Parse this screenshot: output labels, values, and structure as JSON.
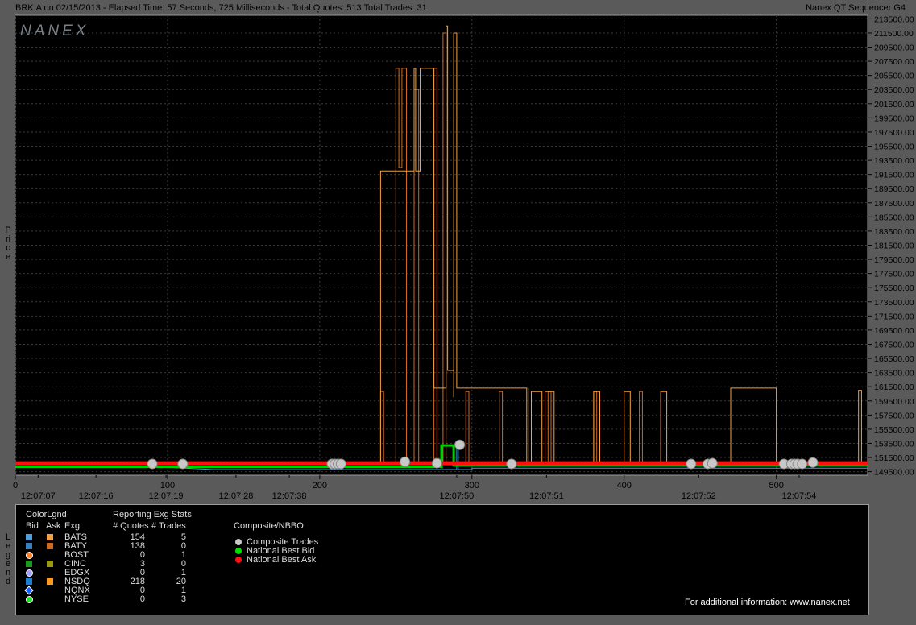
{
  "header": {
    "left": "BRK.A on 02/15/2013  -  Elapsed Time: 57 Seconds, 725 Milliseconds  -  Total Quotes: 513  Total Trades: 31",
    "right": "Nanex QT Sequencer G4"
  },
  "watermark": "NANEX",
  "price_axis_title": "Price",
  "legend_axis_title": "Legend",
  "chart_data": {
    "type": "line",
    "y_ticks": [
      "213500.00",
      "211500.00",
      "209500.00",
      "207500.00",
      "205500.00",
      "203500.00",
      "201500.00",
      "199500.00",
      "197500.00",
      "195500.00",
      "193500.00",
      "191500.00",
      "189500.00",
      "187500.00",
      "185500.00",
      "183500.00",
      "181500.00",
      "179500.00",
      "177500.00",
      "175500.00",
      "173500.00",
      "171500.00",
      "169500.00",
      "167500.00",
      "165500.00",
      "163500.00",
      "161500.00",
      "159500.00",
      "157500.00",
      "155500.00",
      "153500.00",
      "151500.00",
      "149500.00"
    ],
    "ylim": [
      149000,
      214000
    ],
    "xlim": [
      0,
      560
    ],
    "x_ticks": [
      0,
      100,
      200,
      300,
      400,
      500
    ],
    "x_tick_labels": [
      "0",
      "100",
      "200",
      "300",
      "400",
      "500"
    ],
    "time_labels": [
      {
        "x": 15,
        "t": "12:07:07"
      },
      {
        "x": 53,
        "t": "12:07:16"
      },
      {
        "x": 99,
        "t": "12:07:19"
      },
      {
        "x": 145,
        "t": "12:07:28"
      },
      {
        "x": 180,
        "t": "12:07:38"
      },
      {
        "x": 290,
        "t": "12:07:50"
      },
      {
        "x": 349,
        "t": "12:07:51"
      },
      {
        "x": 449,
        "t": "12:07:52"
      },
      {
        "x": 515,
        "t": "12:07:54"
      }
    ],
    "grid": true,
    "series": [
      {
        "id": "baty_ask",
        "color": "#d2691e",
        "points": [
          [
            0,
            150500
          ],
          [
            240,
            150500
          ],
          [
            240,
            160800
          ],
          [
            242,
            160800
          ],
          [
            242,
            150500
          ],
          [
            250,
            150500
          ],
          [
            250,
            206500
          ],
          [
            252,
            206500
          ],
          [
            252,
            192500
          ],
          [
            254,
            192500
          ],
          [
            254,
            206500
          ],
          [
            257,
            206500
          ],
          [
            257,
            150500
          ],
          [
            262,
            150500
          ],
          [
            262,
            203500
          ],
          [
            265,
            203500
          ],
          [
            265,
            150500
          ],
          [
            275,
            150500
          ],
          [
            275,
            206500
          ],
          [
            277,
            206500
          ],
          [
            277,
            150500
          ],
          [
            281,
            150500
          ],
          [
            281,
            211500
          ],
          [
            283,
            211500
          ],
          [
            283,
            150500
          ],
          [
            296,
            150500
          ],
          [
            296,
            160800
          ],
          [
            298,
            160800
          ],
          [
            298,
            150500
          ],
          [
            318,
            150500
          ],
          [
            318,
            160800
          ],
          [
            320,
            160800
          ],
          [
            320,
            150500
          ],
          [
            350,
            150500
          ],
          [
            350,
            160800
          ],
          [
            352,
            160800
          ],
          [
            352,
            150500
          ],
          [
            380,
            150500
          ],
          [
            380,
            160800
          ],
          [
            382,
            160800
          ],
          [
            382,
            150500
          ],
          [
            410,
            150500
          ],
          [
            410,
            160800
          ],
          [
            412,
            160800
          ],
          [
            412,
            150500
          ],
          [
            560,
            150500
          ]
        ]
      },
      {
        "id": "nsdq_ask",
        "color": "#f5a040",
        "points": [
          [
            0,
            150600
          ],
          [
            240,
            150600
          ],
          [
            240,
            192000
          ],
          [
            262,
            192000
          ],
          [
            262,
            206500
          ],
          [
            263,
            206500
          ],
          [
            263,
            192000
          ],
          [
            266,
            192000
          ],
          [
            266,
            206500
          ],
          [
            275,
            206500
          ],
          [
            275,
            161300
          ],
          [
            283,
            161300
          ],
          [
            283,
            212500
          ],
          [
            284,
            212500
          ],
          [
            284,
            163800
          ],
          [
            288,
            163800
          ],
          [
            288,
            160000
          ],
          [
            288,
            211500
          ],
          [
            290,
            211500
          ],
          [
            290,
            161300
          ],
          [
            300,
            161300
          ],
          [
            300,
            161300
          ],
          [
            336,
            161300
          ],
          [
            336,
            150600
          ],
          [
            337,
            150600
          ],
          [
            337,
            161300
          ],
          [
            337,
            150600
          ],
          [
            339,
            150600
          ],
          [
            339,
            160800
          ],
          [
            346,
            160800
          ],
          [
            346,
            150600
          ],
          [
            348,
            150600
          ],
          [
            348,
            160800
          ],
          [
            354,
            160800
          ],
          [
            354,
            150600
          ],
          [
            380,
            150600
          ],
          [
            380,
            160800
          ],
          [
            384,
            160800
          ],
          [
            384,
            150600
          ],
          [
            400,
            150600
          ],
          [
            400,
            160800
          ],
          [
            404,
            160800
          ],
          [
            404,
            150600
          ],
          [
            424,
            150600
          ],
          [
            424,
            160800
          ],
          [
            428,
            160800
          ],
          [
            428,
            150600
          ],
          [
            470,
            150600
          ],
          [
            470,
            161300
          ],
          [
            500,
            161300
          ],
          [
            500,
            150600
          ],
          [
            554,
            150600
          ],
          [
            554,
            161000
          ],
          [
            556,
            161000
          ],
          [
            556,
            150600
          ],
          [
            560,
            150600
          ]
        ]
      },
      {
        "id": "bats_bid",
        "color": "#4aa0e0",
        "points": [
          [
            0,
            150100
          ],
          [
            100,
            150100
          ],
          [
            130,
            149800
          ],
          [
            290,
            149800
          ],
          [
            290,
            153200
          ],
          [
            291,
            153200
          ],
          [
            291,
            149800
          ],
          [
            300,
            149800
          ],
          [
            300,
            150000
          ],
          [
            560,
            150000
          ]
        ]
      },
      {
        "id": "nbb",
        "color": "#00d000",
        "width": 3,
        "points": [
          [
            0,
            150200
          ],
          [
            280,
            150200
          ],
          [
            280,
            153200
          ],
          [
            288,
            153200
          ],
          [
            288,
            150400
          ],
          [
            560,
            150400
          ]
        ]
      },
      {
        "id": "nba",
        "color": "#ff1010",
        "width": 5,
        "points": [
          [
            0,
            150700
          ],
          [
            560,
            150700
          ]
        ]
      }
    ],
    "trades": [
      {
        "x": 90,
        "y": 150600
      },
      {
        "x": 110,
        "y": 150600
      },
      {
        "x": 208,
        "y": 150600
      },
      {
        "x": 210,
        "y": 150600
      },
      {
        "x": 212,
        "y": 150600
      },
      {
        "x": 214,
        "y": 150600
      },
      {
        "x": 256,
        "y": 150900
      },
      {
        "x": 277,
        "y": 150700
      },
      {
        "x": 292,
        "y": 153300
      },
      {
        "x": 326,
        "y": 150600
      },
      {
        "x": 444,
        "y": 150600
      },
      {
        "x": 455,
        "y": 150600
      },
      {
        "x": 458,
        "y": 150700
      },
      {
        "x": 505,
        "y": 150600
      },
      {
        "x": 510,
        "y": 150600
      },
      {
        "x": 512,
        "y": 150600
      },
      {
        "x": 514,
        "y": 150600
      },
      {
        "x": 517,
        "y": 150600
      },
      {
        "x": 524,
        "y": 150800
      }
    ]
  },
  "legend": {
    "color_legend_title": "ColorLgnd",
    "bid_col": "Bid",
    "ask_col": "Ask",
    "exg_col": "Exg",
    "stats_title": "Reporting Exg Stats",
    "quotes_col": "# Quotes",
    "trades_col": "# Trades",
    "rows": [
      {
        "exg": "BATS",
        "quotes": "154",
        "trades": "5",
        "bid_color": "#4aa0e0",
        "ask_color": "#f5a040",
        "shape": "square"
      },
      {
        "exg": "BATY",
        "quotes": "138",
        "trades": "0",
        "bid_color": "#3a80c0",
        "ask_color": "#d2691e",
        "shape": "square"
      },
      {
        "exg": "BOST",
        "quotes": "0",
        "trades": "1",
        "bid_color": "#ff7f27",
        "ask_color": "",
        "shape": "circle"
      },
      {
        "exg": "CINC",
        "quotes": "3",
        "trades": "0",
        "bid_color": "#1a9a1a",
        "ask_color": "#9a9a10",
        "shape": "square"
      },
      {
        "exg": "EDGX",
        "quotes": "0",
        "trades": "1",
        "bid_color": "#a0a0ff",
        "ask_color": "",
        "shape": "circle"
      },
      {
        "exg": "NSDQ",
        "quotes": "218",
        "trades": "20",
        "bid_color": "#1a7fd0",
        "ask_color": "#ff9a1a",
        "shape": "square"
      },
      {
        "exg": "NQNX",
        "quotes": "0",
        "trades": "1",
        "bid_color": "#1a60ff",
        "ask_color": "",
        "shape": "diamond"
      },
      {
        "exg": "NYSE",
        "quotes": "0",
        "trades": "3",
        "bid_color": "#20e020",
        "ask_color": "",
        "shape": "circle"
      }
    ],
    "composite_title": "Composite/NBBO",
    "composite": [
      {
        "label": "Composite Trades",
        "color": "#c8c8c8"
      },
      {
        "label": "National Best Bid",
        "color": "#00e000"
      },
      {
        "label": "National Best Ask",
        "color": "#ff1010"
      }
    ],
    "footer": "For additional information: www.nanex.net"
  }
}
